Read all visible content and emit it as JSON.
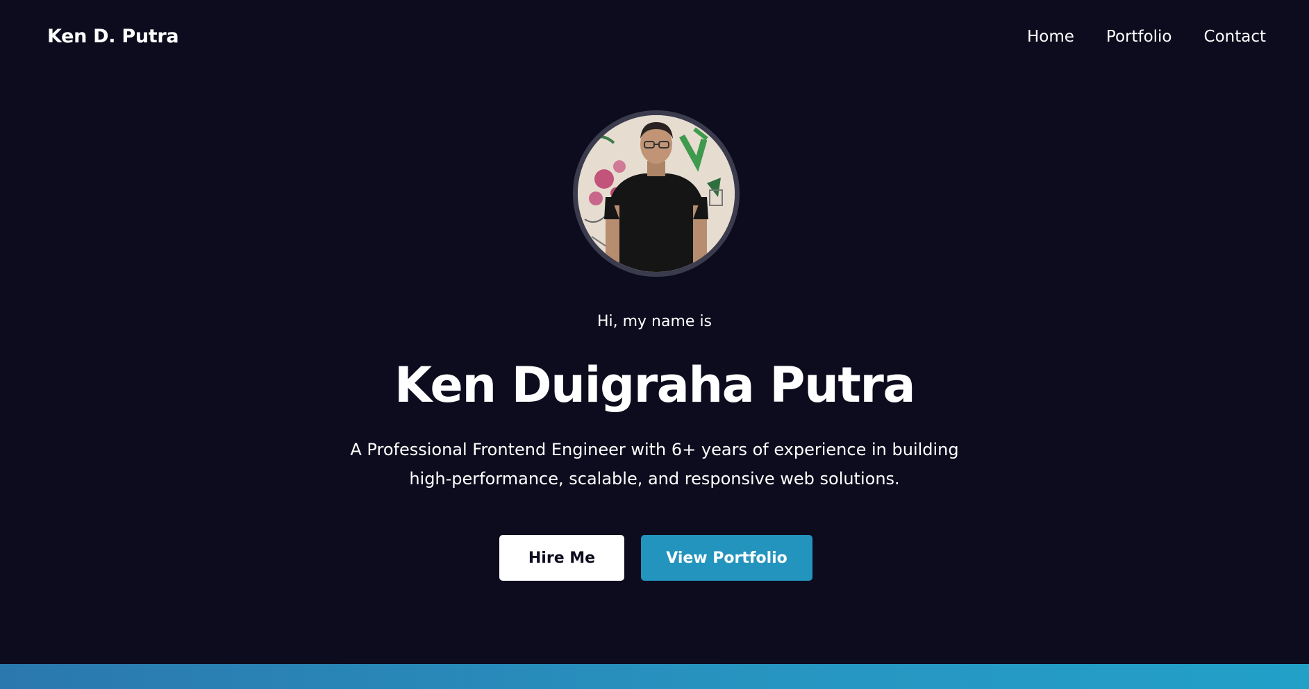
{
  "header": {
    "brand": "Ken D. Putra",
    "nav": [
      {
        "label": "Home"
      },
      {
        "label": "Portfolio"
      },
      {
        "label": "Contact"
      }
    ]
  },
  "hero": {
    "greeting": "Hi, my name is",
    "name": "Ken Duigraha Putra",
    "description": "A Professional Frontend Engineer with 6+ years of experience in building high-performance, scalable, and responsive web solutions.",
    "buttons": {
      "hire": "Hire Me",
      "portfolio": "View Portfolio"
    }
  },
  "colors": {
    "background": "#0c0c1e",
    "accent": "#2394be",
    "avatar_border": "#3b3b4e"
  }
}
